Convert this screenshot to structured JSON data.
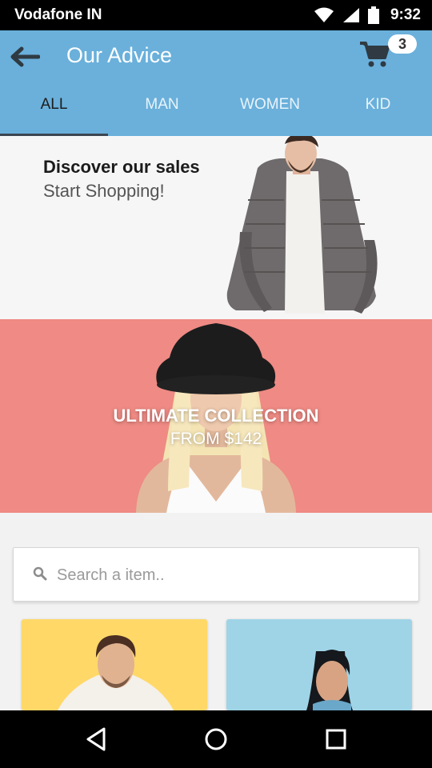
{
  "status_bar": {
    "carrier": "Vodafone IN",
    "time": "9:32"
  },
  "app_bar": {
    "title": "Our Advice",
    "cart_count": "3"
  },
  "tabs": [
    {
      "label": "ALL",
      "active": true
    },
    {
      "label": "MAN",
      "active": false
    },
    {
      "label": "WOMEN",
      "active": false
    },
    {
      "label": "KID",
      "active": false
    }
  ],
  "promo_banner": {
    "title": "Discover our sales",
    "subtitle": "Start Shopping!"
  },
  "collection_banner": {
    "title": "ULTIMATE COLLECTION",
    "price_text": "FROM $142"
  },
  "search": {
    "placeholder": "Search a item.."
  },
  "colors": {
    "primary": "#6ab0db",
    "banner_red": "#ef8a84",
    "card_yellow": "#ffd868",
    "card_blue": "#9fd4e7"
  }
}
